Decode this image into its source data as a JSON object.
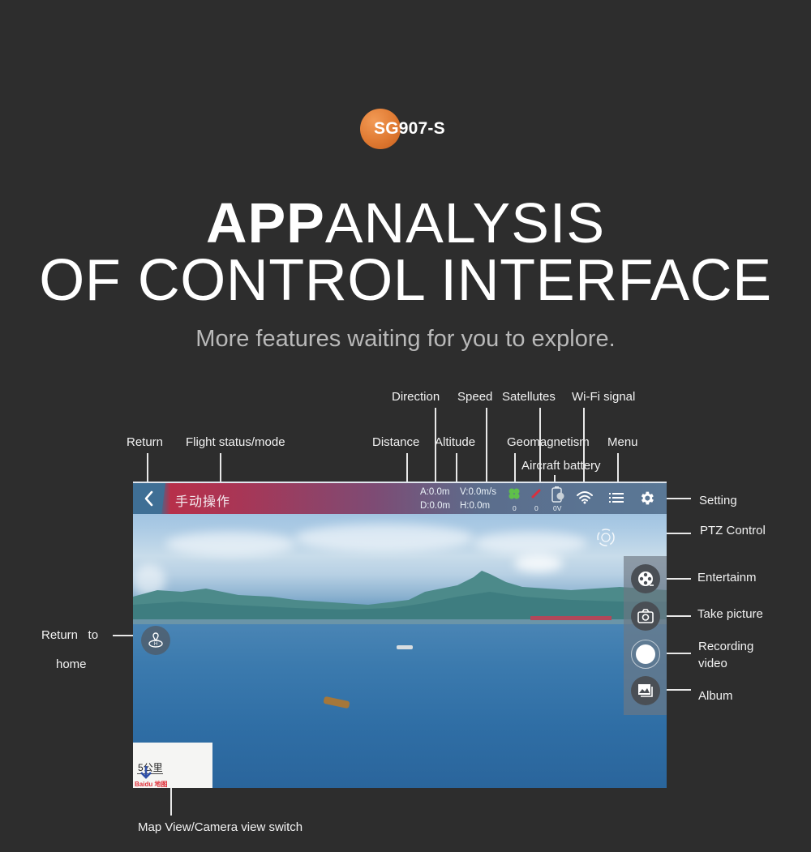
{
  "brand": {
    "model": "SG907-S",
    "badge_color": "#e07a32"
  },
  "headline": {
    "line1_bold": "APP",
    "line1_rest": "ANALYSIS",
    "line2": "OF CONTROL INTERFACE",
    "subtitle": "More features waiting for you to explore."
  },
  "callouts": {
    "return": "Return",
    "flight_status": "Flight status/mode",
    "distance": "Distance",
    "direction": "Direction",
    "altitude": "Altitude",
    "speed": "Speed",
    "satellites": "Satellutes",
    "geomagnetism": "Geomagnetism",
    "aircraft_battery": "Aircraft battery",
    "wifi_signal": "Wi-Fi signal",
    "menu": "Menu",
    "setting": "Setting",
    "ptz_control": "PTZ Control",
    "entertainment": "Entertainm",
    "take_picture": "Take picture",
    "recording_video_1": "Recording",
    "recording_video_2": "video",
    "album": "Album",
    "return_home_1": "Return   to",
    "return_home_2": "home",
    "map_switch": "Map View/Camera view switch"
  },
  "app": {
    "mode_label": "手动操作",
    "telemetry": {
      "direction": "A:0.0m",
      "distance": "D:0.0m",
      "speed": "V:0.0m/s",
      "altitude": "H:0.0m",
      "satellites_count": "0",
      "geomagnetism_count": "0",
      "battery_voltage": "0V"
    },
    "minimap": {
      "scale": "5公里",
      "logo": "Baidu 地图"
    },
    "icons": {
      "back": "chevron-left-icon",
      "satellites": "satellite-icon",
      "geomagnetism": "compass-icon",
      "battery": "battery-icon",
      "wifi": "wifi-icon",
      "menu": "menu-icon",
      "settings": "gear-icon",
      "ptz": "gimbal-icon",
      "entertainment": "film-reel-icon",
      "camera": "camera-icon",
      "record": "record-icon",
      "album": "album-icon",
      "return_home": "home-pin-icon"
    },
    "colors": {
      "satellite": "#5fbf4a",
      "geomagnetism": "#d9303e"
    }
  }
}
